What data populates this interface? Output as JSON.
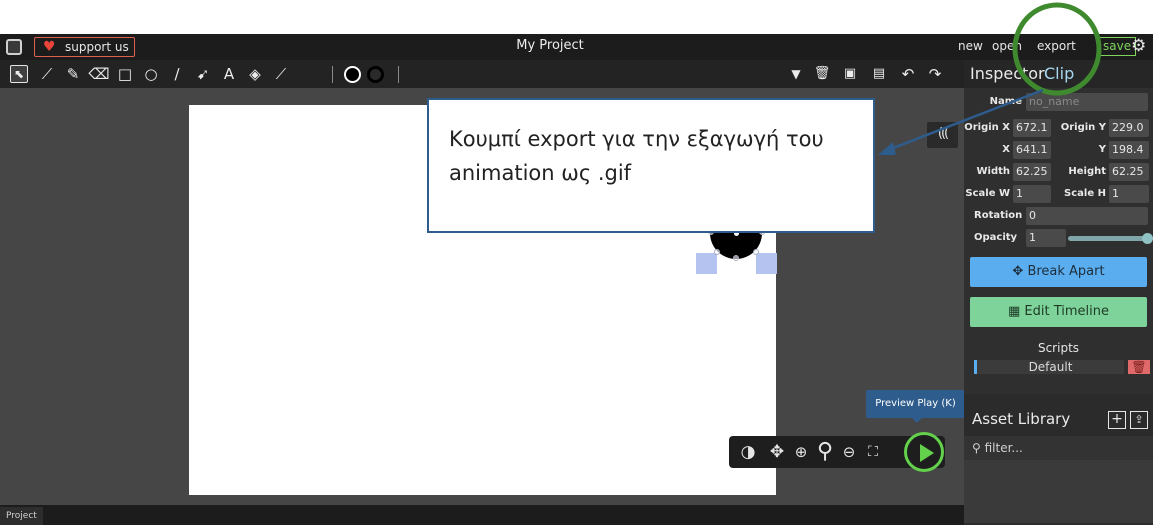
{
  "menubar": {
    "support_label": "support us",
    "project_title": "My Project",
    "new_label": "new",
    "open_label": "open",
    "export_label": "export",
    "save_label": "save",
    "settings_icon": "gear-icon"
  },
  "toolbar": {
    "tools": [
      {
        "name": "cursor",
        "glyph": "⬉"
      },
      {
        "name": "brush",
        "glyph": "⁄"
      },
      {
        "name": "pencil",
        "glyph": "✎"
      },
      {
        "name": "eraser",
        "glyph": "⌫"
      },
      {
        "name": "rectangle",
        "glyph": "□"
      },
      {
        "name": "ellipse",
        "glyph": "○"
      },
      {
        "name": "line",
        "glyph": "∕"
      },
      {
        "name": "pathcursor",
        "glyph": "➹"
      },
      {
        "name": "text",
        "glyph": "A"
      },
      {
        "name": "fillbucket",
        "glyph": "◈"
      },
      {
        "name": "eyedropper",
        "glyph": "⟋"
      }
    ],
    "fill_color": "#000000",
    "stroke_color": "#000000",
    "right_tools": [
      {
        "name": "dropdown",
        "glyph": "▼"
      },
      {
        "name": "delete",
        "glyph": "🗑"
      },
      {
        "name": "copy",
        "glyph": "▣"
      },
      {
        "name": "paste",
        "glyph": "▤"
      },
      {
        "name": "undo",
        "glyph": "↶"
      },
      {
        "name": "redo",
        "glyph": "↷"
      }
    ]
  },
  "canvas": {
    "collapse_glyph": "((("
  },
  "tooltip": {
    "text": "Preview Play (K)"
  },
  "statusbar": {
    "project_tab": "Project"
  },
  "inspector": {
    "title": "Inspector",
    "type": "Clip",
    "name_label": "Name",
    "name_placeholder": "no_name",
    "fields": {
      "origin_x_label": "Origin X",
      "origin_x": "672.1",
      "origin_y_label": "Origin Y",
      "origin_y": "229.0",
      "x_label": "X",
      "x": "641.1",
      "y_label": "Y",
      "y": "198.4",
      "width_label": "Width",
      "width": "62.25",
      "height_label": "Height",
      "height": "62.25",
      "scale_w_label": "Scale W",
      "scale_w": "1",
      "scale_h_label": "Scale H",
      "scale_h": "1",
      "rotation_label": "Rotation",
      "rotation": "0",
      "opacity_label": "Opacity",
      "opacity": "1"
    },
    "break_apart_label": "Break Apart",
    "edit_timeline_label": "Edit Timeline",
    "scripts_label": "Scripts",
    "script_default": "Default"
  },
  "asset_library": {
    "title": "Asset Library",
    "filter_placeholder": "filter..."
  },
  "annotation": {
    "callout_text": "Κουμπί export για την εξαγωγή του animation ως .gif",
    "circle_color": "#3f8a2e",
    "arrow_color": "#2e5c8c"
  }
}
